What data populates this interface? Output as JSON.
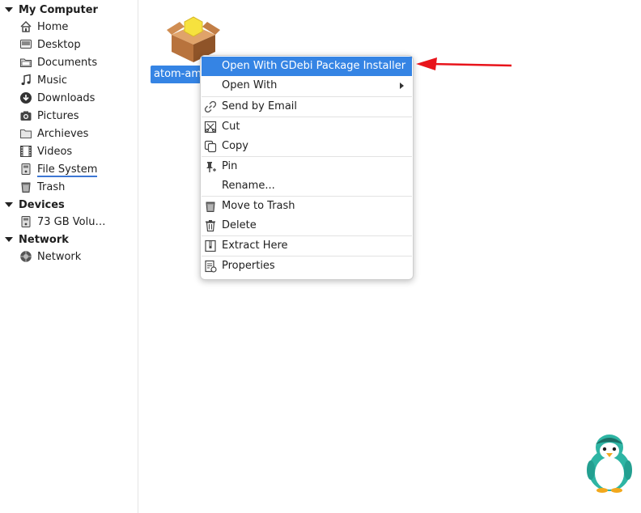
{
  "sidebar": {
    "sections": [
      {
        "title": "My Computer"
      },
      {
        "title": "Devices"
      },
      {
        "title": "Network"
      }
    ],
    "items": [
      {
        "label": "Home",
        "icon": "home-icon"
      },
      {
        "label": "Desktop",
        "icon": "desktop-icon"
      },
      {
        "label": "Documents",
        "icon": "documents-icon"
      },
      {
        "label": "Music",
        "icon": "music-icon"
      },
      {
        "label": "Downloads",
        "icon": "downloads-icon"
      },
      {
        "label": "Pictures",
        "icon": "camera-icon"
      },
      {
        "label": "Archieves",
        "icon": "folder-icon"
      },
      {
        "label": "Videos",
        "icon": "film-icon"
      },
      {
        "label": "File System",
        "icon": "drive-icon"
      },
      {
        "label": "Trash",
        "icon": "trash-icon"
      },
      {
        "label": "73 GB Volu…",
        "icon": "drive-icon"
      },
      {
        "label": "Network",
        "icon": "network-icon"
      }
    ]
  },
  "file": {
    "label": "atom-amd",
    "icon": "package-icon"
  },
  "context_menu": {
    "items": [
      {
        "label": "Open With GDebi Package Installer",
        "icon": ""
      },
      {
        "label": "Open With",
        "icon": ""
      },
      {
        "label": "Send by Email",
        "icon": "link-icon"
      },
      {
        "label": "Cut",
        "icon": "scissors-icon"
      },
      {
        "label": "Copy",
        "icon": "copy-icon"
      },
      {
        "label": "Pin",
        "icon": "pin-icon"
      },
      {
        "label": "Rename...",
        "icon": ""
      },
      {
        "label": "Move to Trash",
        "icon": "trash-icon"
      },
      {
        "label": "Delete",
        "icon": "delete-icon"
      },
      {
        "label": "Extract Here",
        "icon": "extract-icon"
      },
      {
        "label": "Properties",
        "icon": "properties-icon"
      }
    ]
  },
  "colors": {
    "selection": "#3584e4",
    "annotation_arrow": "#e8141b",
    "mascot": "#2eb5a4"
  }
}
